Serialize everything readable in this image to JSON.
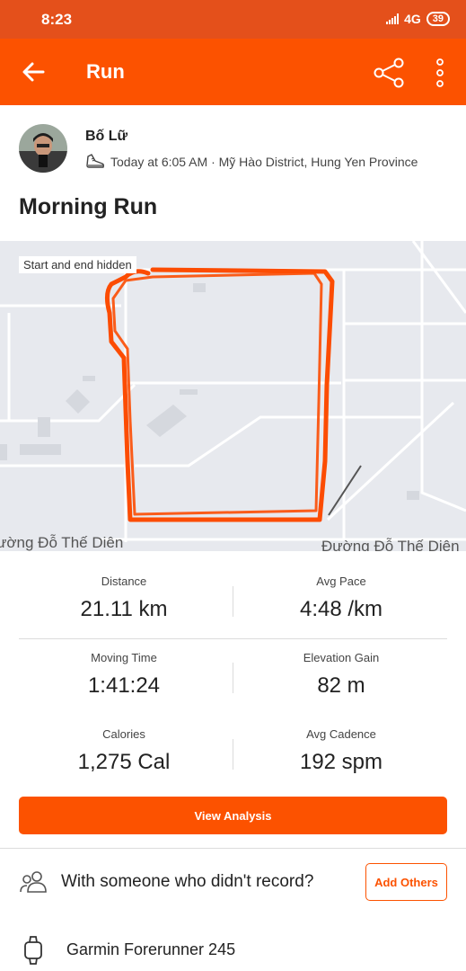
{
  "status_bar": {
    "time": "8:23",
    "network": "4G",
    "battery": "39"
  },
  "app_bar": {
    "title": "Run",
    "back_icon": "arrow-left-icon",
    "share_icon": "share-icon",
    "menu_icon": "more-vertical-icon"
  },
  "athlete": {
    "name": "Bố Lữ",
    "meta": "Today at 6:05 AM · Mỹ Hào District, Hung Yen Province"
  },
  "activity": {
    "title": "Morning Run"
  },
  "map": {
    "privacy_label": "Start and end hidden",
    "street_left": "ường Đỗ Thế Diên",
    "street_right": "Đường Đỗ Thế Diên",
    "route_color": "#fc4c02"
  },
  "stats": [
    {
      "label": "Distance",
      "value": "21.11 km"
    },
    {
      "label": "Avg Pace",
      "value": "4:48 /km"
    },
    {
      "label": "Moving Time",
      "value": "1:41:24"
    },
    {
      "label": "Elevation Gain",
      "value": "82 m"
    },
    {
      "label": "Calories",
      "value": "1,275 Cal"
    },
    {
      "label": "Avg Cadence",
      "value": "192 spm"
    }
  ],
  "actions": {
    "view_analysis": "View Analysis",
    "others_prompt": "With someone who didn't record?",
    "add_others": "Add Others"
  },
  "device": {
    "name": "Garmin Forerunner 245"
  },
  "colors": {
    "accent": "#fc5200",
    "status_bar": "#e4501b"
  }
}
